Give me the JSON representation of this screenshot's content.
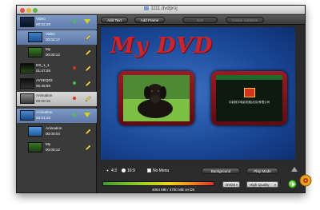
{
  "window": {
    "title": "1111.dvdproj"
  },
  "sidebar": {
    "items": [
      {
        "name": "Video",
        "time": "00:02:29",
        "marker": "green",
        "action": "expand"
      },
      {
        "name": "Video",
        "time": "00:02:17",
        "marker": "green",
        "action": "edit"
      },
      {
        "name": "My",
        "time": "00:00:12",
        "marker": "green",
        "action": "edit"
      },
      {
        "name": "DS_1_1",
        "time": "01:47:28",
        "marker": "red",
        "action": "edit"
      },
      {
        "name": "AVSEQ03",
        "time": "00:45:59",
        "marker": "green",
        "action": "edit"
      },
      {
        "name": "Animation",
        "time": "00:00:15",
        "marker": "red",
        "action": "edit"
      },
      {
        "name": "Animation",
        "time": "00:01:16",
        "marker": "green",
        "action": "expand"
      },
      {
        "name": "Animation",
        "time": "00:00:04",
        "marker": "green",
        "action": "edit"
      },
      {
        "name": "My",
        "time": "00:00:12",
        "marker": "green",
        "action": "edit"
      }
    ]
  },
  "toolbar": {
    "add_text": "Add Text",
    "add_frame": "Add Frame",
    "edit": "Edit",
    "create_subtitles": "Create Subtitles"
  },
  "preview": {
    "menu_title": "My DVD",
    "right_logo_text": "中影数字电影发展(北京)有限公司"
  },
  "options": {
    "aspect_43": "4:3",
    "aspect_169": "16:9",
    "no_menu": "No Menu",
    "background": "Background",
    "play_mode": "Play Mode"
  },
  "status": {
    "capacity_text": "4064 MB / 4700 MB on D5",
    "capacity_fraction": 0.86,
    "disc_type": "DVD5",
    "quality": "High Quality"
  },
  "icons": {
    "expand": "triangle-down-icon",
    "edit": "pencil-icon",
    "up": "arrow-up-icon",
    "burn": "burn-play-icon",
    "app": "app-icon"
  }
}
